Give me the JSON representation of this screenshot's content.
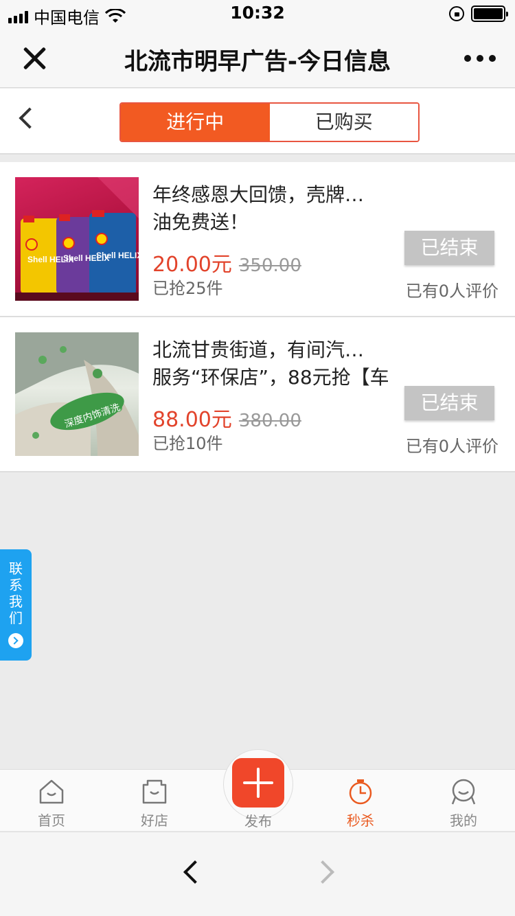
{
  "status_bar": {
    "carrier": "中国电信",
    "time": "10:32"
  },
  "title_bar": {
    "title": "北流市明早广告-今日信息"
  },
  "segment": {
    "active_label": "进行中",
    "inactive_label": "已购买"
  },
  "products": [
    {
      "title_line1": "年终感恩大回馈，壳牌…",
      "title_line2": "油免费送！",
      "price": "20.00元",
      "original_price": "350.00",
      "sold": "已抢25件",
      "status": "已结束",
      "reviews": "已有0人评价",
      "image_label": "Shell HELIX"
    },
    {
      "title_line1": "北流甘贵街道，有间汽…",
      "title_line2": "服务“环保店”，88元抢【车",
      "price": "88.00元",
      "original_price": "380.00",
      "sold": "已抢10件",
      "status": "已结束",
      "reviews": "已有0人评价",
      "image_label": "深度内饰清洗"
    }
  ],
  "contact": {
    "label": "联系我们"
  },
  "tabbar": {
    "home": "首页",
    "shops": "好店",
    "publish": "发布",
    "flash_sale": "秒杀",
    "mine": "我的"
  },
  "colors": {
    "accent": "#f25a22",
    "price": "#e2432b",
    "contact": "#1ea2f0"
  }
}
